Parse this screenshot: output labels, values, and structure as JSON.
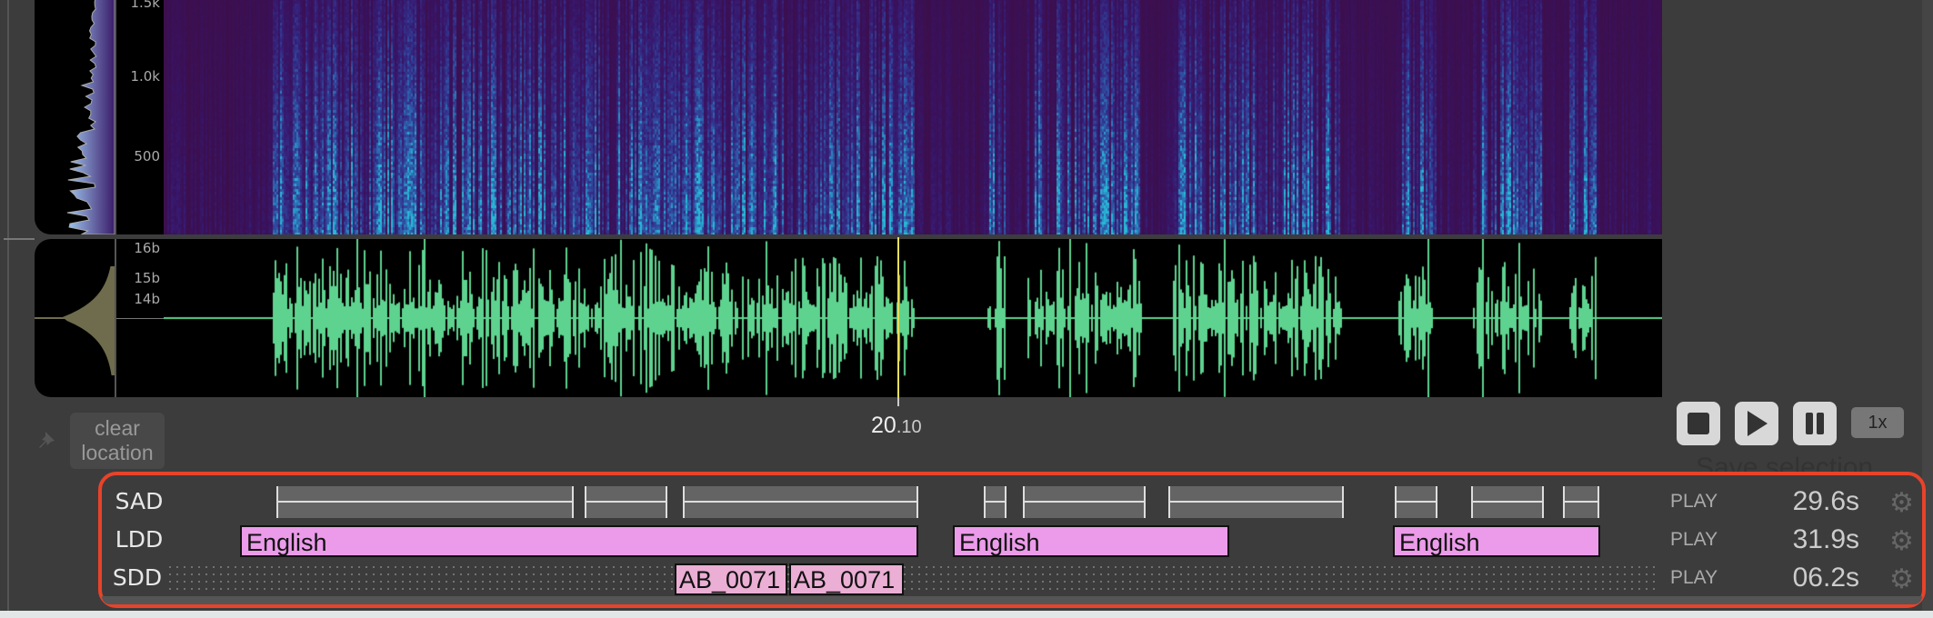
{
  "spectrogram": {
    "freq_ticks": [
      "1.5k",
      "1.0k",
      "500"
    ]
  },
  "waveform": {
    "amp_ticks": [
      "16b",
      "15b",
      "14b"
    ]
  },
  "playhead": {
    "time_main": "20",
    "time_frac": ".10"
  },
  "clear_location_button": {
    "line1": "clear",
    "line2": "location"
  },
  "transport": {
    "stop": "stop",
    "play": "play",
    "pause": "pause",
    "speed": "1x",
    "save_selection": "Save selection..."
  },
  "tracks": [
    {
      "label": "SAD",
      "play": "PLAY",
      "duration": "29.6s"
    },
    {
      "label": "LDD",
      "play": "PLAY",
      "duration": "31.9s",
      "segments": [
        "English",
        "English",
        "English"
      ]
    },
    {
      "label": "SDD",
      "play": "PLAY",
      "duration": "06.2s",
      "segments": [
        "AB_0071",
        "AB_0071"
      ]
    }
  ],
  "colors": {
    "highlight_box": "#e8432a",
    "ldd": "#eb9be9",
    "sdd": "#ebaed4",
    "waveform": "#5ed38f",
    "playhead": "#e6e05a"
  }
}
